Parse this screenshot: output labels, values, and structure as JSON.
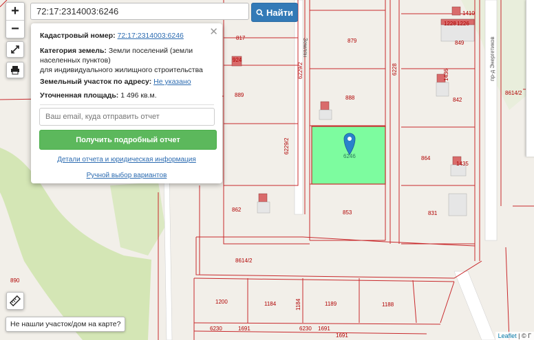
{
  "search": {
    "value": "72:17:2314003:6246",
    "button_label": "Найти"
  },
  "zoom": {
    "in": "+",
    "out": "−"
  },
  "popup": {
    "cadastral_label": "Кадастровый номер:",
    "cadastral_value": "72:17:2314003:6246",
    "category_label": "Категория земель:",
    "category_value": "Земли поселений (земли",
    "category_value_2": "населенных пунктов)",
    "category_value_3": "для индивидуального жилищного строительства",
    "address_label": "Земельный участок по адресу:",
    "address_value": "Не указано",
    "area_label": "Уточненная площадь:",
    "area_value": "1 496 кв.м.",
    "email_placeholder": "Ваш email, куда отправить отчет",
    "report_button": "Получить подробный отчет",
    "details_link": "Детали отчета и юридическая информация",
    "manual_link": "Ручной выбор вариантов"
  },
  "not_found_button": "Не нашли участок/дом на карте?",
  "attribution": {
    "leaflet": "Leaflet",
    "sep": "| ©",
    "rest": "Г"
  },
  "map": {
    "selected_plot_label": "6246",
    "selected_color": "#7dfc9f",
    "boundary_color": "#c8282b",
    "plot_labels": [
      "879",
      "817",
      "924",
      "1410",
      "1228",
      "1226",
      "849",
      "889",
      "888",
      "6228",
      "842",
      "1436",
      "6229/2",
      "6229/2",
      "8614/2",
      "864",
      "1435",
      "862",
      "853",
      "831",
      "8614/2",
      "890",
      "1200",
      "1184",
      "1184",
      "1189",
      "1188",
      "6230",
      "1691",
      "6230",
      "1691",
      "1691"
    ],
    "street_labels": [
      "Землян",
      "пр-д Энергетиков"
    ]
  },
  "colors": {
    "primary": "#337ab7",
    "success": "#5cb85c",
    "marker": "#2a81cb"
  },
  "icons": [
    "fullscreen-icon",
    "print-icon",
    "ruler-icon",
    "search-icon",
    "map-marker-icon",
    "close-icon"
  ]
}
